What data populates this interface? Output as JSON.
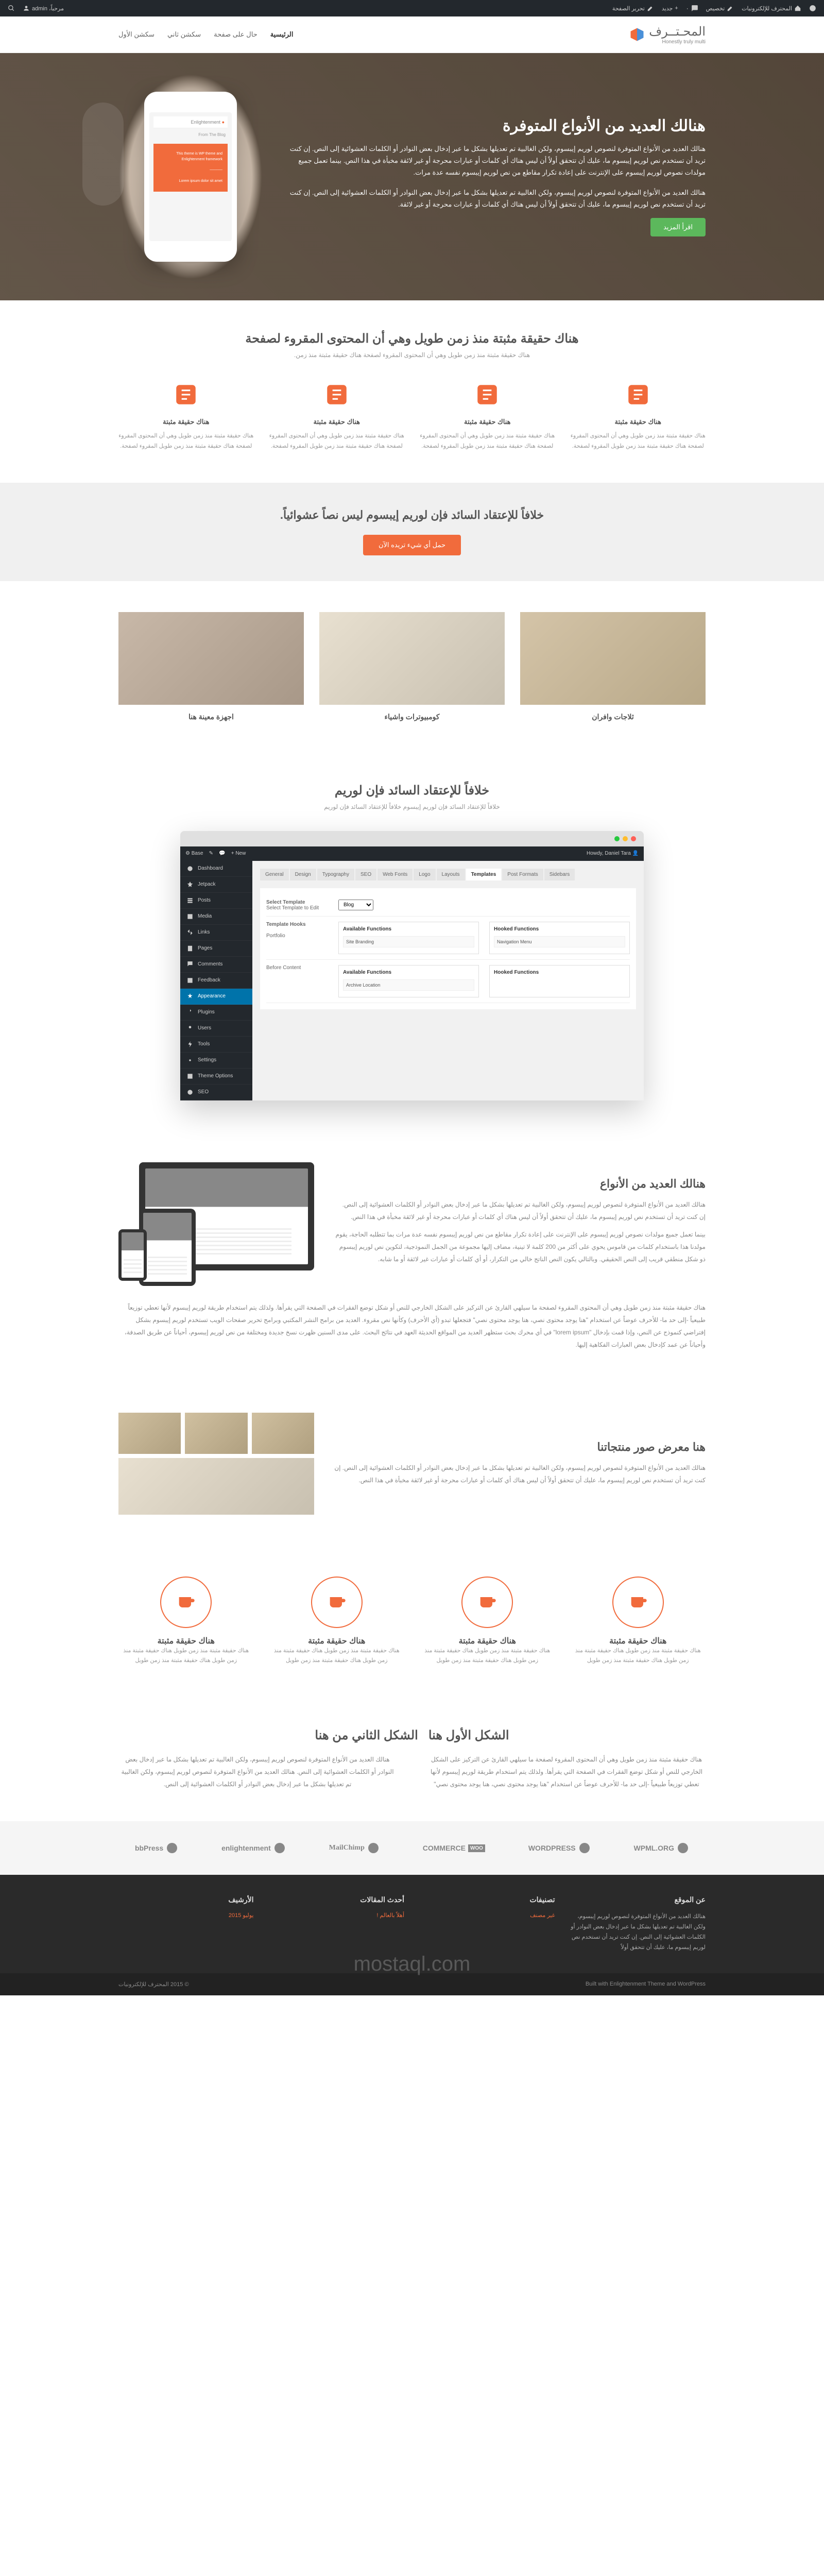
{
  "adminbar": {
    "site": "المحترف للإلكترونيات",
    "customize": "تخصيص",
    "comments": "٠",
    "new": "جديد",
    "edit": "تحرير الصفحة",
    "greeting": "مرحباً، admin"
  },
  "logo": {
    "main": "المحـتــرف",
    "sub": "Honestly truly multi"
  },
  "nav": [
    "الرئيسية",
    "حال على صفحة",
    "سكشن ثاني",
    "سكشن الأول"
  ],
  "hero": {
    "title": "هنالك العديد من الأنواع المتوفرة",
    "p1": "هنالك العديد من الأنواع المتوفرة لنصوص لوريم إيبسوم، ولكن الغالبية تم تعديلها بشكل ما عبر إدخال بعض النوادر أو الكلمات العشوائية إلى النص. إن كنت تريد أن تستخدم نص لوريم إيبسوم ما، عليك أن تتحقق أولاً أن ليس هناك أي كلمات أو عبارات محرجة أو غير لائقة مخبأة في هذا النص. بينما تعمل جميع مولدات نصوص لوريم إيبسوم على الإنترنت على إعادة تكرار مقاطع من نص لوريم إيبسوم نفسه عدة مرات.",
    "p2": "هنالك العديد من الأنواع المتوفرة لنصوص لوريم إيبسوم، ولكن الغالبية تم تعديلها بشكل ما عبر إدخال بعض النوادر أو الكلمات العشوائية إلى النص. إن كنت تريد أن تستخدم نص لوريم إيبسوم ما، عليك أن تتحقق أولاً أن ليس هناك أي كلمات أو عبارات محرجة أو غير لائقة.",
    "btn": "اقرأ المزيد",
    "phone_title": "Enlightenment",
    "phone_sub": "From The Blog"
  },
  "sec1": {
    "title": "هناك حقيقة مثبتة منذ زمن طويل وهي أن المحتوى المقروء لصفحة",
    "sub": "هناك حقيقة مثبتة منذ زمن طويل وهي أن المحتوى المقروء لصفحة هناك حقيقة مثبتة منذ زمن.",
    "feat_title": "هناك حقيقة مثبتة",
    "feat_text": "هناك حقيقة مثبتة منذ زمن طويل وهي أن المحتوى المقروء لصفحة هناك حقيقة مثبتة منذ زمن طويل المقروء لصفحة."
  },
  "cta": {
    "title": "خلافاً للإعتقاد السائد فإن لوريم إيبسوم ليس نصاً عشوائياً.",
    "btn": "حمل أي شيء تريده الآن"
  },
  "cats": {
    "c1": "ثلاجات وافران",
    "c2": "كومبيوترات واشياء",
    "c3": "اجهزة معينة هنا"
  },
  "sec2": {
    "title": "خلافاً للإعتقاد السائد فإن لوريم",
    "sub": "خلافاً للإعتقاد السائد فإن لوريم إيبسوم خلافاً للإعتقاد السائد فإن لوريم"
  },
  "wp": {
    "menu": [
      "Dashboard",
      "Jetpack",
      "Posts",
      "Media",
      "Links",
      "Pages",
      "Comments",
      "Feedback",
      "Appearance",
      "Plugins",
      "Users",
      "Tools",
      "Settings",
      "Theme Options",
      "SEO"
    ],
    "tabs": [
      "General",
      "Design",
      "Typography",
      "SEO",
      "Web Fonts",
      "Logo",
      "Layouts",
      "Templates",
      "Post Formats",
      "Sidebars"
    ],
    "active_tab": "Templates",
    "select_label": "Select Template",
    "select_sub": "Select Template to Edit",
    "select_val": "Blog",
    "hooks_label": "Template Hooks",
    "portfolio": "Portfolio",
    "avail": "Available Functions",
    "hooked": "Hooked Functions",
    "site_branding": "Site Branding",
    "nav_menu": "Navigation Menu",
    "before_content": "Before Content",
    "archive_loc": "Archive Location"
  },
  "variety": {
    "title": "هنالك العديد من الأنواع",
    "p1": "هنالك العديد من الأنواع المتوفرة لنصوص لوريم إيبسوم، ولكن الغالبية تم تعديلها بشكل ما عبر إدخال بعض النوادر أو الكلمات العشوائية إلى النص. إن كنت تريد أن تستخدم نص لوريم إيبسوم ما، عليك أن تتحقق أولاً أن ليس هناك أي كلمات أو عبارات محرجة أو غير لائقة مخبأة في هذا النص.",
    "p2": "بينما تعمل جميع مولدات نصوص لوريم إيبسوم على الإنترنت على إعادة تكرار مقاطع من نص لوريم إيبسوم نفسه عدة مرات بما تتطلبه الحاجة، يقوم مولدنا هذا باستخدام كلمات من قاموس يحوي على أكثر من 200 كلمة لا تينية، مضاف إليها مجموعة من الجمل النموذجية، لتكوين نص لوريم إيبسوم ذو شكل منطقي قريب إلى النص الحقيقي. وبالتالي يكون النص الناتج خالي من التكرار، أو أي كلمات أو عبارات غير لائقة أو ما شابه.",
    "full": "هناك حقيقة مثبتة منذ زمن طويل وهي أن المحتوى المقروء لصفحة ما سيلهي القارئ عن التركيز على الشكل الخارجي للنص أو شكل توضع الفقرات في الصفحة التي يقرأها. ولذلك يتم استخدام طريقة لوريم إيبسوم لأنها تعطي توزيعاً طبيعياً -إلى حد ما- للأحرف عوضاً عن استخدام \"هنا يوجد محتوى نصي، هنا يوجد محتوى نصي\" فتجعلها تبدو (أي الأحرف) وكأنها نص مقروء. العديد من برامح النشر المكتبي وبرامح تحرير صفحات الويب تستخدم لوريم إيبسوم بشكل إفتراضي كنموذج عن النص، وإذا قمت بإدخال \"lorem ipsum\" في أي محرك بحث ستظهر العديد من المواقع الحديثة العهد في نتائج البحث. على مدى السنين ظهرت نسخ جديدة ومختلفة من نص لوريم إيبسوم، أحياناً عن طريق الصدفة، وأحياناً عن عمد كإدخال بعض العبارات الفكاهية إليها."
  },
  "gallery": {
    "title": "هنا معرض صور منتجاتنا",
    "text": "هنالك العديد من الأنواع المتوفرة لنصوص لوريم إيبسوم، ولكن الغالبية تم تعديلها بشكل ما عبر إدخال بعض النوادر أو الكلمات العشوائية إلى النص. إن كنت تريد أن تستخدم نص لوريم إيبسوم ما، عليك أن تتحقق أولاً أن ليس هناك أي كلمات أو عبارات محرجة أو غير لائقة مخبأة في هذا النص."
  },
  "circles": {
    "title": "هناك حقيقة مثبتة",
    "text": "هناك حقيقة مثبتة منذ زمن طويل هناك حقيقة مثبتة منذ زمن طويل هناك حقيقة مثبتة منذ زمن طويل"
  },
  "twotext": {
    "t1": "الشكل الأول هنا",
    "t2": "الشكل الثاني من هنا",
    "p1": "هناك حقيقة مثبتة منذ زمن طويل وهي أن المحتوى المقروء لصفحة ما سيلهي القارئ عن التركيز على الشكل الخارجي للنص أو شكل توضع الفقرات في الصفحة التي يقرأها. ولذلك يتم استخدام طريقة لوريم إيبسوم لأنها تعطي توزيعاً طبيعياً -إلى حد ما- للأحرف عوضاً عن استخدام \"هنا يوجد محتوى نصي، هنا يوجد محتوى نصي\"",
    "p2": "هنالك العديد من الأنواع المتوفرة لنصوص لوريم إيبسوم، ولكن الغالبية تم تعديلها بشكل ما عبر إدخال بعض النوادر أو الكلمات العشوائية إلى النص. هنالك العديد من الأنواع المتوفرة لنصوص لوريم إيبسوم، ولكن الغالبية تم تعديلها بشكل ما عبر إدخال بعض النوادر أو الكلمات العشوائية إلى النص."
  },
  "logos": [
    "WPML.ORG",
    "WORDPRESS",
    "WOO COMMERCE",
    "MailChimp",
    "enlightenment",
    "bbPress"
  ],
  "footer": {
    "about_t": "عن الموقع",
    "about_p": "هنالك العديد من الأنواع المتوفرة لنصوص لوريم إيبسوم، ولكن الغالبية تم تعديلها بشكل ما عبر إدخال بعض النوادر أو الكلمات العشوائية إلى النص. إن كنت تريد أن تستخدم نص لوريم إيبسوم ما، عليك أن تتحقق أولاً",
    "cat_t": "تصنيفات",
    "cat_l": "غير مصنف",
    "posts_t": "أحدث المقالات",
    "posts_l": "أهلاً بالعالم !",
    "arch_t": "الأرشيف",
    "arch_l": "يوليو 2015",
    "copyright": "© 2015 المحترف للإلكترونيات",
    "built": "Built with Enlightenment Theme and WordPress"
  },
  "watermark": "mostaql.com"
}
